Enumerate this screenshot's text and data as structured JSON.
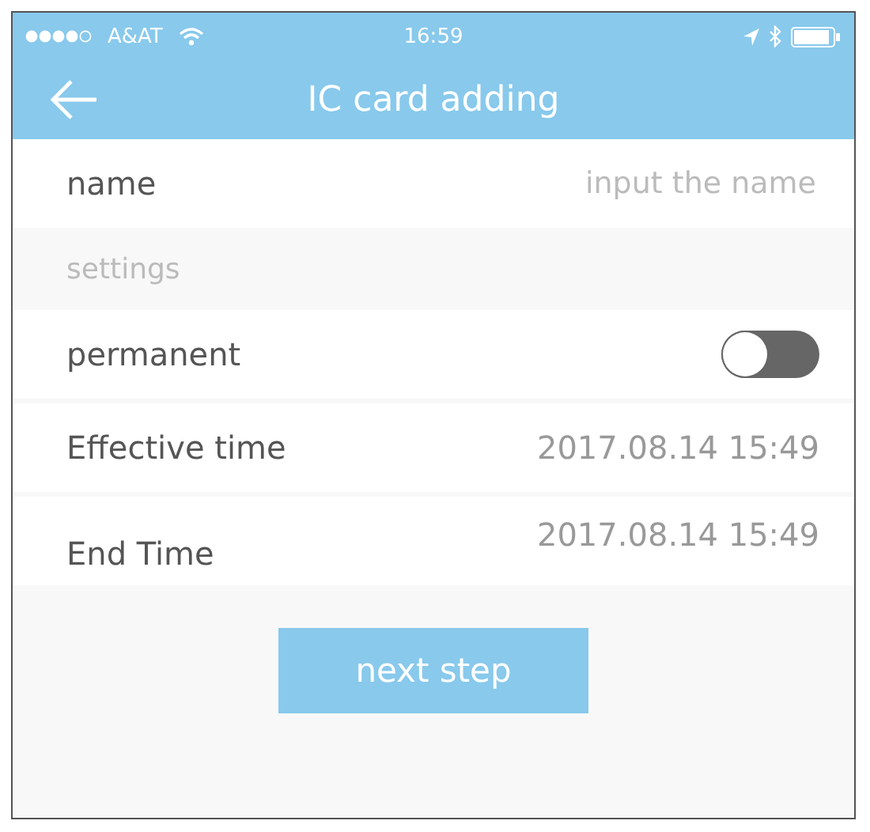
{
  "status_bar": {
    "carrier": "A&AT",
    "time": "16:59"
  },
  "header": {
    "title": "IC card adding"
  },
  "name_field": {
    "label": "name",
    "placeholder": "input the name"
  },
  "section": {
    "label": "settings"
  },
  "rows": [
    {
      "kind": "toggle",
      "label": "permanent",
      "on": false
    },
    {
      "kind": "value",
      "label": "Effective time",
      "value": "2017.08.14 15:49"
    },
    {
      "kind": "value_top",
      "label": "End Time",
      "value": "2017.08.14 15:49"
    }
  ],
  "buttons": [
    "next step"
  ]
}
